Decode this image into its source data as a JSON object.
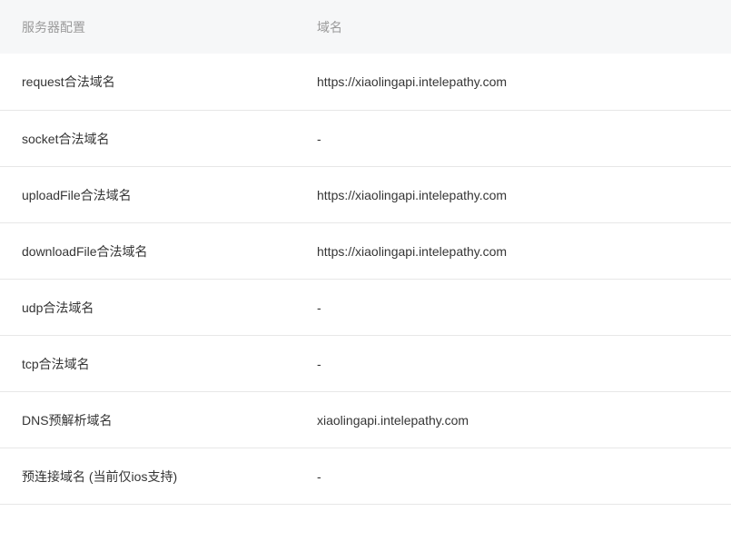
{
  "table": {
    "headers": [
      "服务器配置",
      "域名"
    ],
    "rows": [
      {
        "config": "request合法域名",
        "domain": "https://xiaolingapi.intelepathy.com"
      },
      {
        "config": "socket合法域名",
        "domain": "-"
      },
      {
        "config": "uploadFile合法域名",
        "domain": "https://xiaolingapi.intelepathy.com"
      },
      {
        "config": "downloadFile合法域名",
        "domain": "https://xiaolingapi.intelepathy.com"
      },
      {
        "config": "udp合法域名",
        "domain": "-"
      },
      {
        "config": "tcp合法域名",
        "domain": "-"
      },
      {
        "config": "DNS预解析域名",
        "domain": "xiaolingapi.intelepathy.com"
      },
      {
        "config": "预连接域名 (当前仅ios支持)",
        "domain": "-"
      }
    ]
  }
}
